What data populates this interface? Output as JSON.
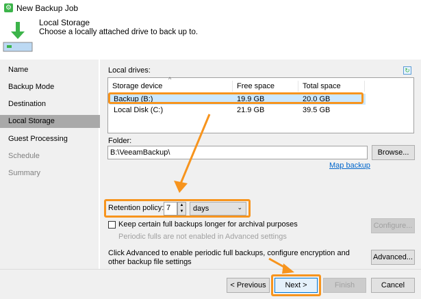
{
  "window": {
    "title": "New Backup Job"
  },
  "header": {
    "title": "Local Storage",
    "subtitle": "Choose a locally attached drive to back up to."
  },
  "sidebar": {
    "items": [
      {
        "label": "Name",
        "state": "normal"
      },
      {
        "label": "Backup Mode",
        "state": "normal"
      },
      {
        "label": "Destination",
        "state": "normal"
      },
      {
        "label": "Local Storage",
        "state": "selected"
      },
      {
        "label": "Guest Processing",
        "state": "normal"
      },
      {
        "label": "Schedule",
        "state": "disabled"
      },
      {
        "label": "Summary",
        "state": "disabled"
      }
    ]
  },
  "drives": {
    "label": "Local drives:",
    "columns": [
      "Storage device",
      "Free space",
      "Total space"
    ],
    "rows": [
      [
        "Backup (B:)",
        "19.9 GB",
        "20.0 GB"
      ],
      [
        "Local Disk (C:)",
        "21.9 GB",
        "39.5 GB"
      ]
    ],
    "selected_row": 0
  },
  "folder": {
    "label": "Folder:",
    "value": "B:\\VeeamBackup\\",
    "browse": "Browse...",
    "map_link": "Map backup"
  },
  "retention": {
    "label": "Retention policy:",
    "value": "7",
    "unit": "days"
  },
  "archival": {
    "label": "Keep certain full backups longer for archival purposes",
    "checked": false,
    "note": "Periodic fulls are not enabled in Advanced settings",
    "configure": "Configure..."
  },
  "advanced": {
    "text": "Click Advanced to enable periodic full backups, configure encryption and other backup file settings",
    "button": "Advanced..."
  },
  "footer": {
    "previous": "< Previous",
    "next": "Next >",
    "finish": "Finish",
    "cancel": "Cancel"
  },
  "colors": {
    "highlight": "#f7941d",
    "selection": "#cce8ff",
    "accent_green": "#3cb44a",
    "link": "#0066cc"
  }
}
